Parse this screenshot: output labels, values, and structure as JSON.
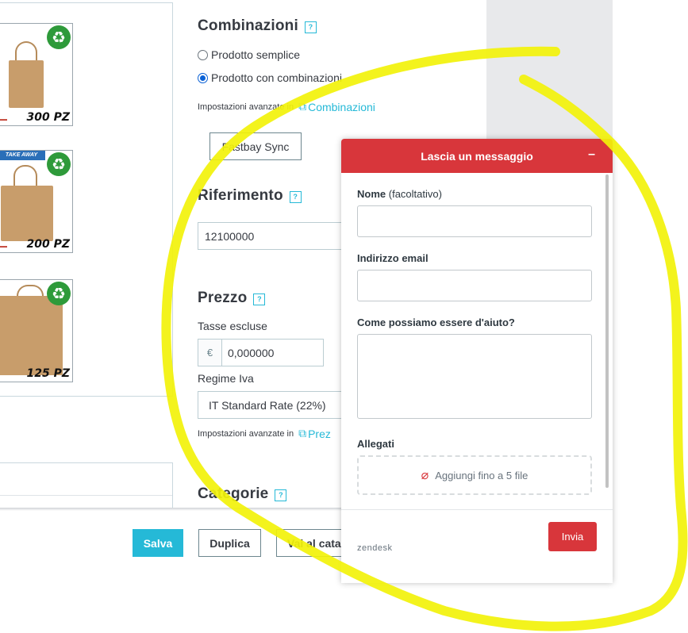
{
  "product_images": [
    {
      "qty_label": "300 PZ",
      "take_away": ""
    },
    {
      "qty_label": "200 PZ",
      "take_away": "TAKE AWAY"
    },
    {
      "qty_label": "125 PZ",
      "take_away": ""
    }
  ],
  "combinations": {
    "title": "Combinazioni",
    "help_icon": "?",
    "option_simple": "Prodotto semplice",
    "option_combinations": "Prodotto con combinazioni",
    "selected": "Prodotto con combinazioni",
    "advanced_text": "Impostazioni avanzate in",
    "advanced_link": "Combinazioni",
    "sync_button": "Fastbay Sync"
  },
  "reference": {
    "title": "Riferimento",
    "help_icon": "?",
    "value": "12100000"
  },
  "price": {
    "title": "Prezzo",
    "help_icon": "?",
    "tax_excluded_label": "Tasse escluse",
    "currency": "€",
    "value": "0,000000",
    "vat_label": "Regime Iva",
    "vat_value": "IT Standard Rate (22%)",
    "advanced_text": "Impostazioni avanzate in",
    "advanced_link": "Prez"
  },
  "categories": {
    "title": "Categorie",
    "help_icon": "?"
  },
  "toolbar": {
    "save": "Salva",
    "duplicate": "Duplica",
    "catalog": "Vai al cata"
  },
  "widget": {
    "title": "Lascia un messaggio",
    "minimize": "–",
    "name_label": "Nome",
    "name_optional": "(facoltativo)",
    "email_label": "Indirizzo email",
    "help_label": "Come possiamo essere d'aiuto?",
    "attachments_label": "Allegati",
    "attach_text": "Aggiungi fino a 5 file",
    "brand": "zendesk",
    "send": "Invia",
    "header_color": "#d8363b"
  },
  "colors": {
    "accent": "#25b9d7",
    "annotation": "#f2f20a"
  }
}
